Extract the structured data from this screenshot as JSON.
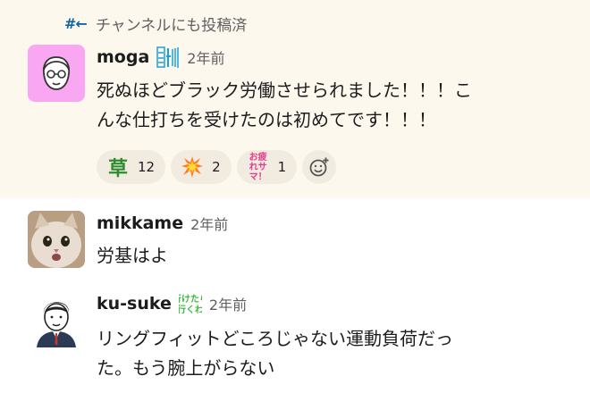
{
  "thread_header": {
    "also_sent_label": "チャンネルにも投稿済"
  },
  "messages": [
    {
      "author": "moga",
      "timestamp": "2年前",
      "status_emoji": "最上川",
      "lines": [
        "死ぬほどブラック労働させられました！！！こ",
        "んな仕打ちを受けたのは初めてです！！！"
      ],
      "reactions": [
        {
          "emoji": "草",
          "count": "12"
        },
        {
          "emoji": "collision-icon",
          "count": "2"
        },
        {
          "emoji": "お疲れサマ！",
          "count": "1"
        }
      ]
    },
    {
      "author": "mikkame",
      "timestamp": "2年前",
      "lines": [
        "労基はよ"
      ]
    },
    {
      "author": "ku-suke",
      "timestamp": "2年前",
      "status_emoji": "行けたら行くわ",
      "lines": [
        "リングフィットどころじゃない運動負荷だっ",
        "た。もう腕上がらない"
      ]
    }
  ],
  "colors": {
    "highlight": "#fdf8ee",
    "reaction_bg": "#f2ece0",
    "link_blue": "#1264a3"
  }
}
